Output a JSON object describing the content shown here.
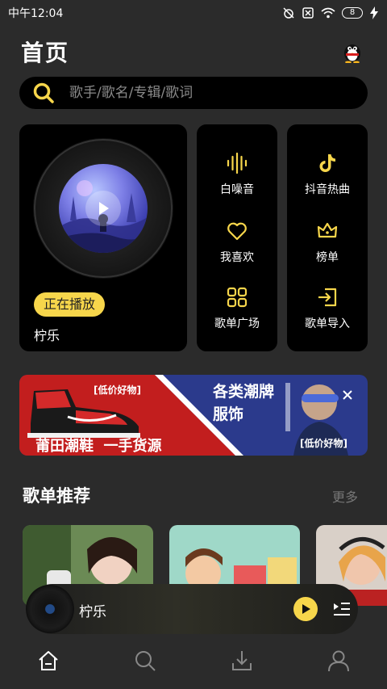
{
  "status_bar": {
    "time": "中午12:04",
    "battery": "8",
    "icons": [
      "alarm-off-icon",
      "sim-off-icon",
      "wifi-icon",
      "battery-icon",
      "charging-icon"
    ]
  },
  "header": {
    "title": "首页",
    "avatar_icon": "qq-penguin-icon"
  },
  "search": {
    "placeholder": "歌手/歌名/专辑/歌词",
    "icon": "search-icon",
    "accent": "#f7d64b"
  },
  "now_playing_card": {
    "badge": "正在播放",
    "song": "柠乐"
  },
  "quick_grid": {
    "column_1": [
      {
        "label": "白噪音",
        "icon": "sound-wave-icon"
      },
      {
        "label": "我喜欢",
        "icon": "heart-icon"
      },
      {
        "label": "歌单广场",
        "icon": "grid-icon"
      }
    ],
    "column_2": [
      {
        "label": "抖音热曲",
        "icon": "tiktok-icon"
      },
      {
        "label": "榜单",
        "icon": "crown-icon"
      },
      {
        "label": "歌单导入",
        "icon": "import-icon"
      }
    ]
  },
  "banner": {
    "left_tag": "[低价好物]",
    "left_text": "莆田潮鞋  一手货源",
    "right_title_1": "各类潮牌",
    "right_title_2": "服饰",
    "right_tag": "[低价好物]",
    "close_icon": "close-icon"
  },
  "playlist_section": {
    "title": "歌单推荐",
    "more": "更多"
  },
  "mini_player": {
    "title": "柠乐",
    "play_icon": "play-icon",
    "list_icon": "playlist-icon"
  },
  "tab_bar": {
    "items": [
      "home-icon",
      "search-icon",
      "download-icon",
      "profile-icon"
    ]
  },
  "colors": {
    "background": "#2b2b2b",
    "card": "#000000",
    "accent": "#f7d64b",
    "banner_red": "#c21e1e",
    "banner_blue": "#2b3a8c"
  }
}
